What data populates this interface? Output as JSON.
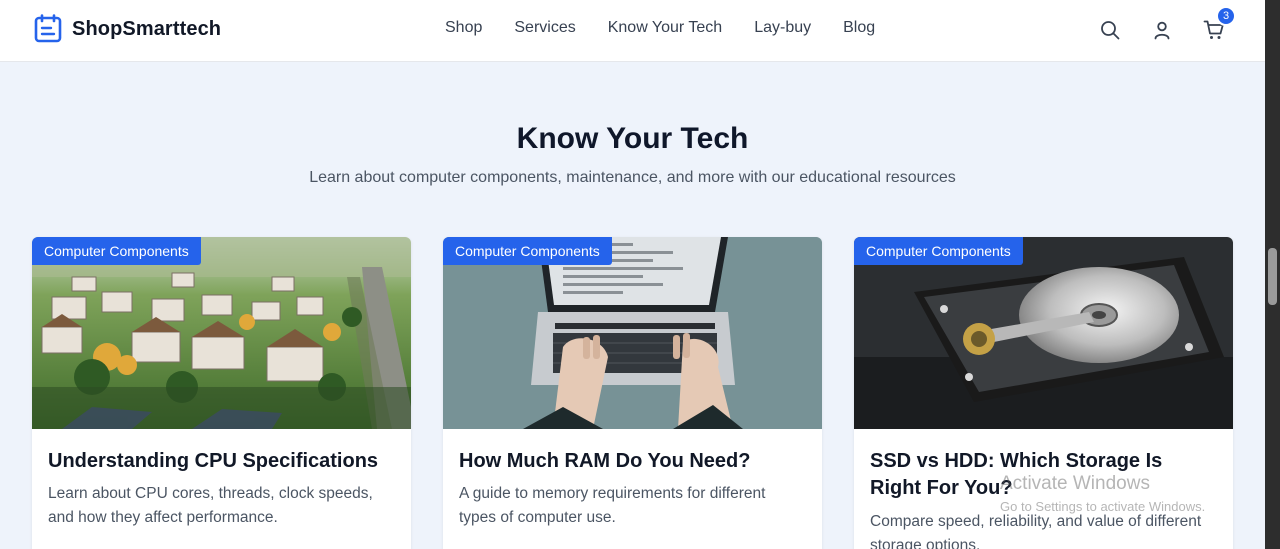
{
  "header": {
    "brand": "ShopSmarttech",
    "nav": [
      "Shop",
      "Services",
      "Know Your Tech",
      "Lay-buy",
      "Blog"
    ],
    "cart_count": "3",
    "icons": [
      "search-icon",
      "user-icon",
      "cart-icon"
    ]
  },
  "hero": {
    "title": "Know Your Tech",
    "subtitle": "Learn about computer components, maintenance, and more with our educational resources"
  },
  "cards": [
    {
      "tag": "Computer Components",
      "title": "Understanding CPU Specifications",
      "description": "Learn about CPU cores, threads, clock speeds, and how they affect performance."
    },
    {
      "tag": "Computer Components",
      "title": "How Much RAM Do You Need?",
      "description": "A guide to memory requirements for different types of computer use."
    },
    {
      "tag": "Computer Components",
      "title": "SSD vs HDD: Which Storage Is Right For You?",
      "description": "Compare speed, reliability, and value of different storage options."
    }
  ],
  "watermark": {
    "title": "Activate Windows",
    "subtitle": "Go to Settings to activate Windows."
  },
  "colors": {
    "accent": "#2563eb",
    "background": "#eef3fb",
    "heading": "#0f172a"
  }
}
